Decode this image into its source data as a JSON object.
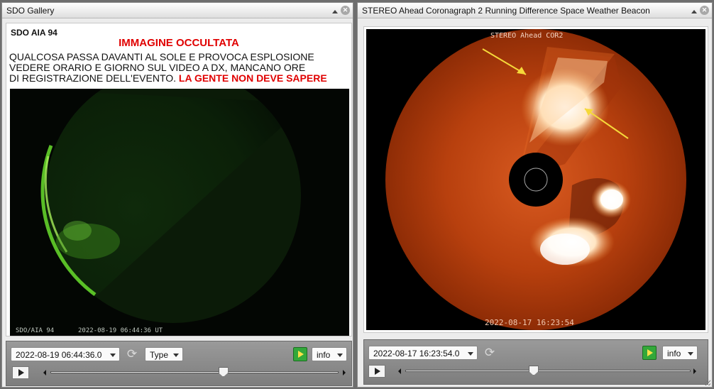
{
  "left_panel": {
    "title": "SDO Gallery",
    "subtitle": "SDO AIA 94",
    "caption_heading": "IMMAGINE OCCULTATA",
    "caption_lines": [
      "QUALCOSA PASSA DAVANTI AL SOLE E PROVOCA ESPLOSIONE",
      "VEDERE ORARIO E GIORNO SUL VIDEO A DX, MANCANO ORE",
      "DI REGISTRAZIONE DELL'EVENTO."
    ],
    "caption_red": "LA GENTE NON DEVE SAPERE",
    "image_label": "SDO/AIA   94",
    "image_timestamp": "2022-08-19 06:44:36 UT",
    "date_select": "2022-08-19 06:44:36.0",
    "type_select": "Type",
    "info_select": "info",
    "slider_position": 0.6
  },
  "right_panel": {
    "title": "STEREO Ahead Coronagraph 2 Running Difference Space Weather Beacon",
    "image_label": "STEREO Ahead COR2",
    "image_timestamp": "2022-08-17 16:23:54",
    "date_select": "2022-08-17 16:23:54.0",
    "info_select": "info",
    "slider_position": 0.45
  },
  "colors": {
    "caption_red": "#e00000",
    "sdo_green": "#3fae19",
    "cme_orange": "#c8400e",
    "arrow_yellow": "#f5d83a"
  },
  "icons": [
    "collapse-icon",
    "close-icon",
    "chevron-down-icon",
    "refresh-icon",
    "movie-icon",
    "play-icon",
    "slider-left-arrow-icon",
    "slider-right-arrow-icon"
  ]
}
